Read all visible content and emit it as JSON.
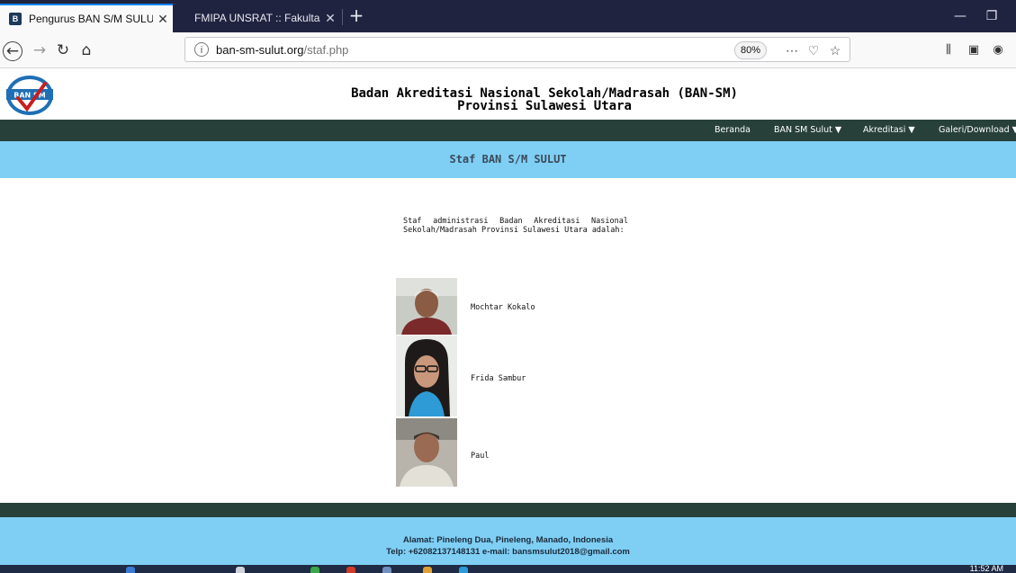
{
  "browser": {
    "tabs": [
      {
        "label": "Pengurus BAN S/M SULUT",
        "favicon": "ban-favicon-icon",
        "active": true
      },
      {
        "label": "FMIPA UNSRAT :: Fakultas MIPA",
        "active": false
      }
    ],
    "new_tab_symbol": "+",
    "url_domain": "ban-sm-sulut.org",
    "url_path": "/staf.php",
    "zoom": "80%"
  },
  "page": {
    "title_line1": "Badan Akreditasi Nasional Sekolah/Madrasah (BAN-SM)",
    "title_line2": "Provinsi Sulawesi Utara",
    "logo_text": "BAN SM",
    "menu": [
      {
        "label": "Beranda"
      },
      {
        "label": "BAN SM Sulut ▼"
      },
      {
        "label": "Akreditasi ▼"
      },
      {
        "label": "Galeri/Download ▼"
      }
    ],
    "banner_title": "Staf BAN S/M SULUT",
    "intro": "Staf administrasi Badan Akreditasi Nasional Sekolah/Madrasah Provinsi Sulawesi Utara adalah:",
    "staff": [
      {
        "name": "Mochtar Kokalo"
      },
      {
        "name": "Frida Sambur"
      },
      {
        "name": "Paul"
      }
    ],
    "footer_address": "Alamat: Pineleng Dua, Pineleng, Manado, Indonesia",
    "footer_contact": "Telp: +62082137148131   e-mail: bansmsulut2018@gmail.com"
  },
  "taskbar": {
    "clock": "11:52 AM"
  },
  "colors": {
    "menubar": "#27403a",
    "banner": "#7fcff5",
    "tabbar": "#202340",
    "active_tab_accent": "#0a84ff"
  }
}
